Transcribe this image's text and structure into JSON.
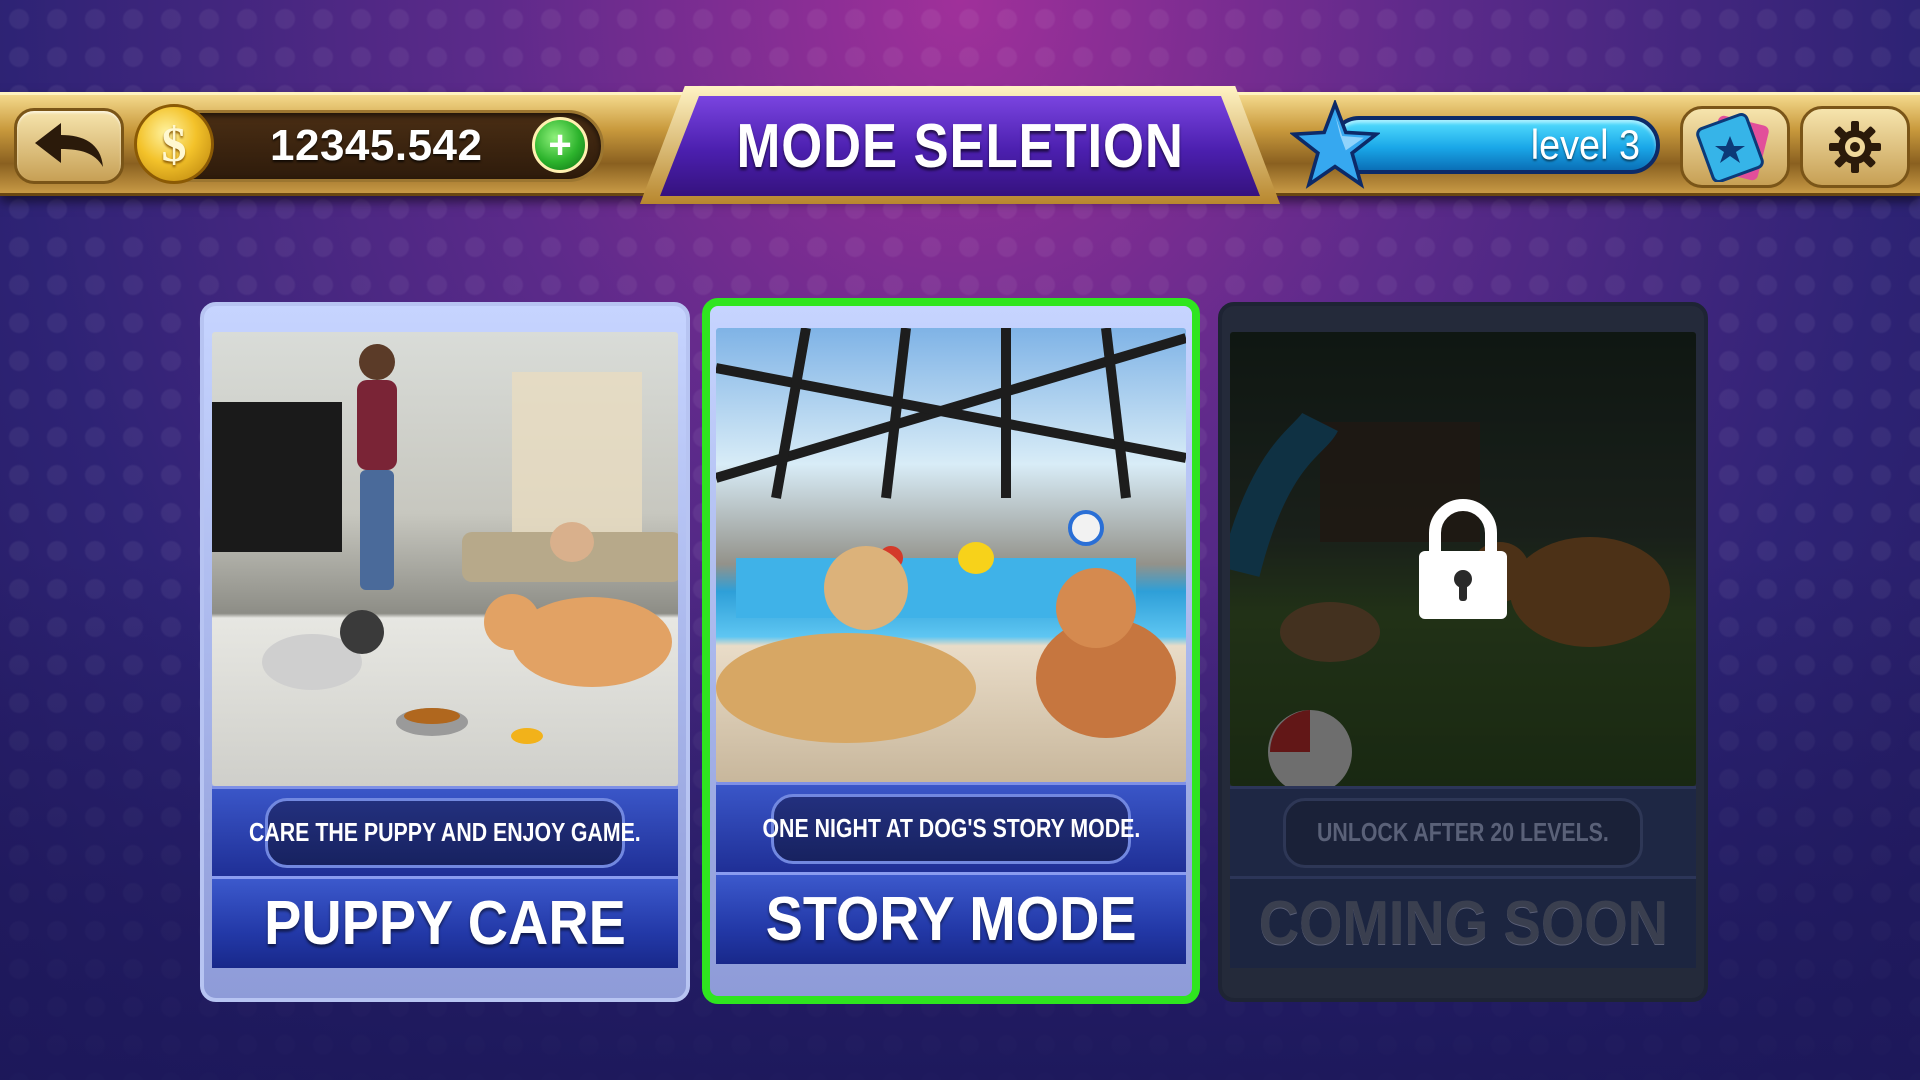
{
  "header": {
    "title": "MODE SELETION",
    "coins": "12345.542",
    "coin_symbol": "$",
    "add_symbol": "+",
    "level": "level 3"
  },
  "modes": [
    {
      "description": "CARE THE PUPPY AND ENJOY GAME.",
      "name": "PUPPY CARE",
      "state": "available",
      "selected": false
    },
    {
      "description": "ONE NIGHT AT DOG'S STORY MODE.",
      "name": "STORY MODE",
      "state": "available",
      "selected": true
    },
    {
      "description": "UNLOCK AFTER 20 LEVELS.",
      "name": "COMING SOON",
      "state": "locked",
      "selected": false
    }
  ],
  "colors": {
    "selected_border": "#2fe51f",
    "gold": "#c99a3d",
    "title_purple": "#4b1fae",
    "level_blue": "#1aa7e8"
  },
  "icons": [
    "back-arrow-icon",
    "dollar-coin-icon",
    "plus-icon",
    "star-icon",
    "ticket-icon",
    "gear-icon",
    "lock-icon"
  ]
}
